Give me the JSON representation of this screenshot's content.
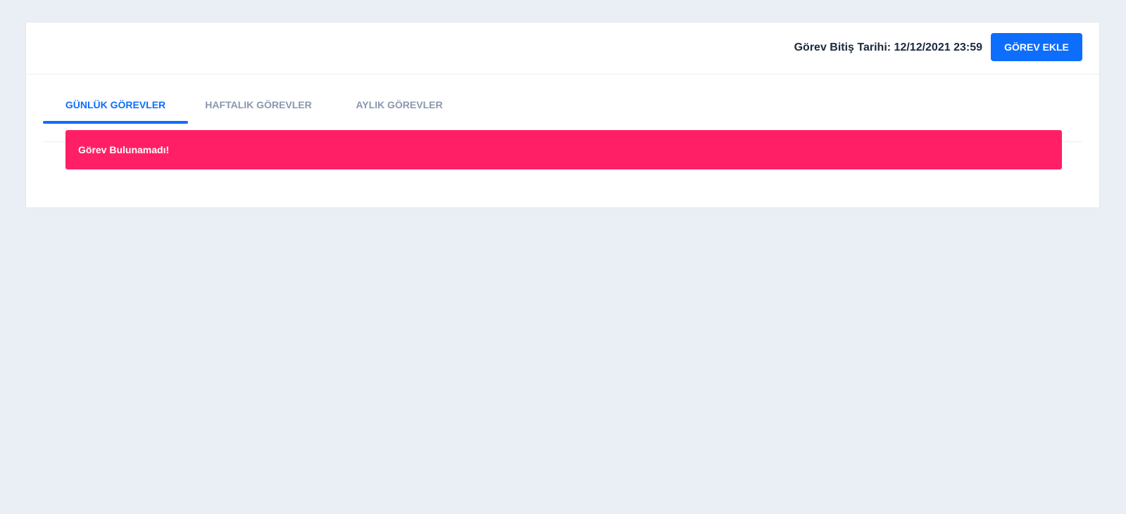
{
  "header": {
    "deadline_text": "Görev Bitiş Tarihi: 12/12/2021 23:59",
    "add_task_label": "GÖREV EKLE"
  },
  "tabs": [
    {
      "label": "GÜNLÜK GÖREVLER",
      "active": true
    },
    {
      "label": "HAFTALIK GÖREVLER",
      "active": false
    },
    {
      "label": "AYLIK GÖREVLER",
      "active": false
    }
  ],
  "alert": {
    "message": "Görev Bulunamadı!"
  },
  "colors": {
    "page_background": "#eaeff6",
    "primary": "#0d6efd",
    "alert": "#ff1f66",
    "tab_inactive": "#8a98ad",
    "heading_text": "#1b2a3d"
  }
}
